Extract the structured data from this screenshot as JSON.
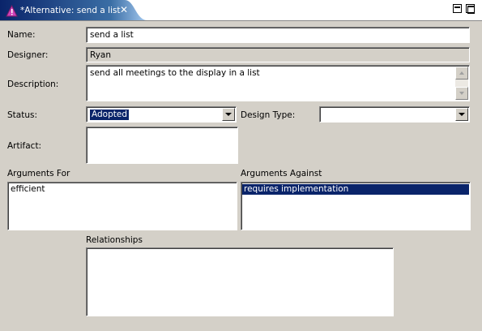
{
  "tab": {
    "title": "*Alternative: send a list",
    "icon": "alternative-triangle-icon",
    "close_icon": "close-icon",
    "active_color": "#0a246a"
  },
  "window_controls": {
    "minimize_icon": "minimize-icon",
    "maximize_icon": "maximize-icon"
  },
  "form": {
    "name_label": "Name:",
    "name_value": "send a list",
    "designer_label": "Designer:",
    "designer_value": "Ryan",
    "description_label": "Description:",
    "description_value": "send all meetings to the display in a list",
    "status_label": "Status:",
    "status_value": "Adopted",
    "design_type_label": "Design Type:",
    "design_type_value": "",
    "artifact_label": "Artifact:"
  },
  "arguments_for": {
    "label": "Arguments For",
    "items": [
      "efficient"
    ]
  },
  "arguments_against": {
    "label": "Arguments Against",
    "items": [
      "requires implementation"
    ],
    "selected_index": 0
  },
  "relationships": {
    "label": "Relationships",
    "items": []
  },
  "colors": {
    "background": "#d4d0c8",
    "selection": "#0a246a"
  }
}
